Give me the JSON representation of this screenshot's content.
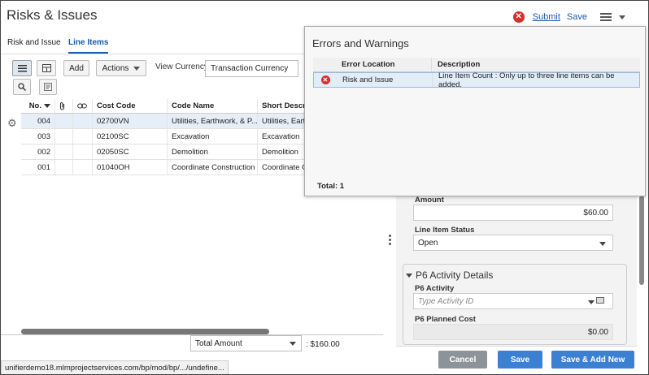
{
  "header": {
    "title": "Risks & Issues",
    "error_icon": "error-x-icon",
    "submit": "Submit",
    "save": "Save",
    "menu_icon": "hamburger-menu-icon"
  },
  "tabs": [
    {
      "label": "Risk and Issue"
    },
    {
      "label": "Line Items"
    }
  ],
  "toolbar": {
    "list_icon": "list-view-icon",
    "grid_icon": "grid-view-icon",
    "add": "Add",
    "actions": "Actions",
    "view_currency_label": "View Currency",
    "view_currency_value": "Transaction Currency",
    "search_icon": "search-icon",
    "filter_icon": "filter-icon"
  },
  "grid": {
    "headers": {
      "no": "No.",
      "cost_code": "Cost Code",
      "code_name": "Code Name",
      "short_desc": "Short Descr"
    },
    "rows": [
      {
        "no": "004",
        "cost_code": "02700VN",
        "code_name": "Utilities, Earthwork, & P...",
        "short_desc": "Utilities, Earth"
      },
      {
        "no": "003",
        "cost_code": "02100SC",
        "code_name": "Excavation",
        "short_desc": "Excavation"
      },
      {
        "no": "002",
        "cost_code": "02050SC",
        "code_name": "Demolition",
        "short_desc": "Demolition"
      },
      {
        "no": "001",
        "cost_code": "01040OH",
        "code_name": "Coordinate Construction",
        "short_desc": "Coordinate C"
      }
    ]
  },
  "footer": {
    "total_label": "Total Amount",
    "total_value": ": $160.00"
  },
  "status_bar": "unifierdemo18.mlmprojectservices.com/bp/mod/bp/.../undefine...",
  "details": {
    "amount_label": "Amount",
    "amount_value": "$60.00",
    "status_label": "Line Item Status",
    "status_value": "Open",
    "p6_section": "P6 Activity Details",
    "p6_activity_label": "P6 Activity",
    "p6_activity_placeholder": "Type Activity ID",
    "p6_cost_label": "P6 Planned Cost",
    "p6_cost_value": "$0.00"
  },
  "buttons": {
    "cancel": "Cancel",
    "save": "Save",
    "save_add_new": "Save & Add New"
  },
  "errors_popup": {
    "title": "Errors and Warnings",
    "headers": {
      "location": "Error Location",
      "description": "Description"
    },
    "rows": [
      {
        "location": "Risk and Issue",
        "description": "Line Item Count : Only up to three line items can be added."
      }
    ],
    "total": "Total: 1"
  },
  "colors": {
    "accent": "#3b80d2",
    "error": "#d62d2d",
    "link": "#1a5aa8"
  }
}
